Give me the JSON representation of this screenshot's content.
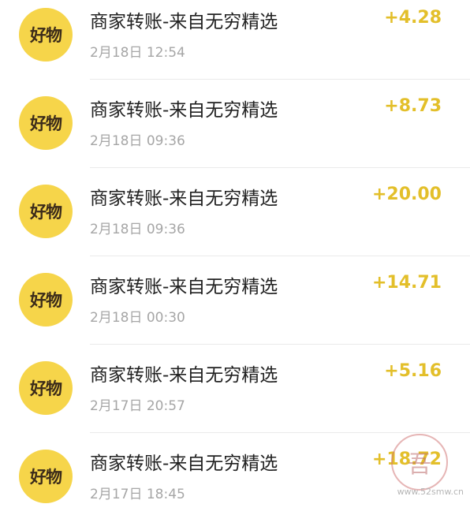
{
  "colors": {
    "avatar_bg": "#f6d54a",
    "amount": "#e3bf2a",
    "time": "#a6a6a6"
  },
  "transactions": [
    {
      "avatar_text": "好物",
      "title": "商家转账-来自无穷精选",
      "time": "2月18日 12:54",
      "amount": "+4.28"
    },
    {
      "avatar_text": "好物",
      "title": "商家转账-来自无穷精选",
      "time": "2月18日 09:36",
      "amount": "+8.73"
    },
    {
      "avatar_text": "好物",
      "title": "商家转账-来自无穷精选",
      "time": "2月18日 09:36",
      "amount": "+20.00"
    },
    {
      "avatar_text": "好物",
      "title": "商家转账-来自无穷精选",
      "time": "2月18日 00:30",
      "amount": "+14.71"
    },
    {
      "avatar_text": "好物",
      "title": "商家转账-来自无穷精选",
      "time": "2月17日 20:57",
      "amount": "+5.16"
    },
    {
      "avatar_text": "好物",
      "title": "商家转账-来自无穷精选",
      "time": "2月17日 18:45",
      "amount": "+18.72"
    }
  ],
  "watermark": {
    "url": "www.52smw.cn",
    "stamp_text": "吾"
  }
}
